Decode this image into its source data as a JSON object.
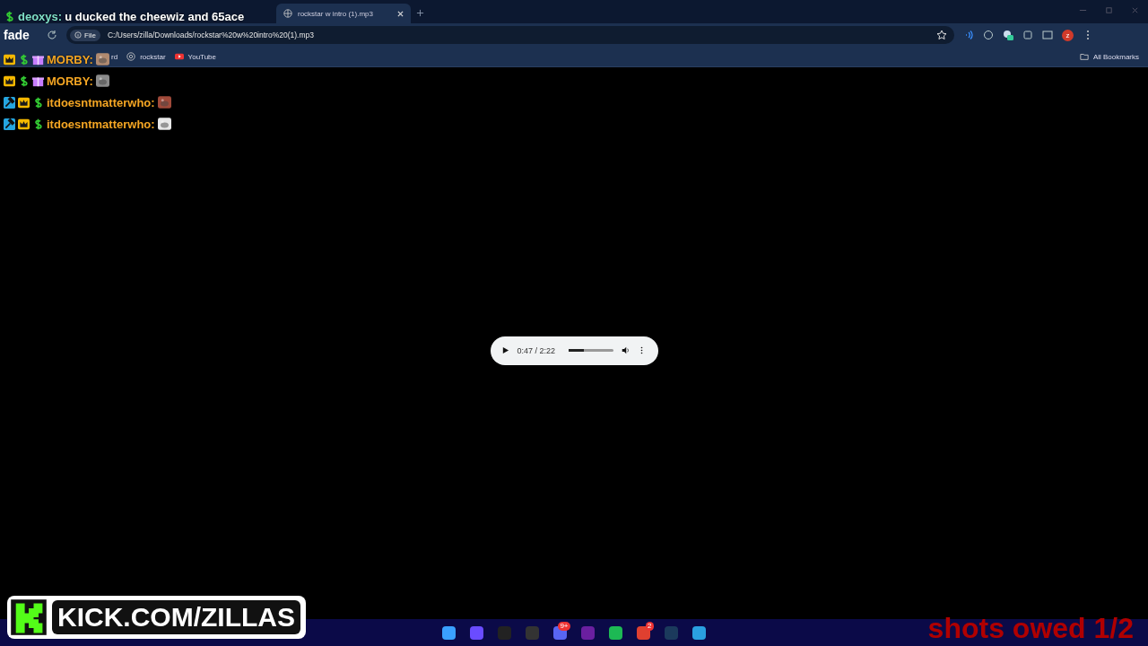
{
  "browser": {
    "tabs": [
      {
        "kind": "file",
        "title": "rockstar w intro (1).mp3",
        "selected": true
      }
    ],
    "address": {
      "chip": "File",
      "url": "C:/Users/zilla/Downloads/rockstar%20w%20intro%20(1).mp3"
    },
    "profile": "z",
    "bookmarks": [
      {
        "kind": "page",
        "label": "rd"
      },
      {
        "kind": "globe",
        "label": "rockstar"
      },
      {
        "kind": "youtube",
        "label": "YouTube"
      }
    ],
    "all_bookmarks": "All Bookmarks"
  },
  "player": {
    "time": "0:47 / 2:22",
    "level": 0.33
  },
  "chat": [
    {
      "kind": "message",
      "badges": [
        {
          "kind": "dollar"
        }
      ],
      "user": "deoxys:",
      "color": "#7fe0c8",
      "text": "u ducked the cheewiz and 65ace"
    },
    {
      "kind": "fragment",
      "text": "fade"
    },
    {
      "kind": "message",
      "badges": [
        {
          "kind": "crown"
        },
        {
          "kind": "dollar"
        },
        {
          "kind": "gift"
        }
      ],
      "user": "MORBY:",
      "color": "#f5a623"
    },
    {
      "kind": "message",
      "badges": [
        {
          "kind": "crown"
        },
        {
          "kind": "dollar"
        },
        {
          "kind": "gift"
        }
      ],
      "user": "MORBY:",
      "color": "#f5a623"
    },
    {
      "kind": "message",
      "badges": [
        {
          "kind": "mod"
        },
        {
          "kind": "crown"
        },
        {
          "kind": "dollar"
        }
      ],
      "user": "itdoesntmatterwho:",
      "color": "#f5a623"
    },
    {
      "kind": "message",
      "badges": [
        {
          "kind": "mod"
        },
        {
          "kind": "crown"
        },
        {
          "kind": "dollar"
        }
      ],
      "user": "itdoesntmatterwho:",
      "color": "#f5a623"
    }
  ],
  "stream": {
    "link": "KICK.COM/ZILLAS",
    "shots": "shots owed 1/2"
  },
  "taskbar": [
    {
      "kind": "windows"
    },
    {
      "kind": "grid"
    },
    {
      "kind": "g"
    },
    {
      "kind": "obs"
    },
    {
      "kind": "discord",
      "badge": "9+"
    },
    {
      "kind": "next"
    },
    {
      "kind": "spotify"
    },
    {
      "kind": "chrome",
      "badge": "2"
    },
    {
      "kind": "steam"
    },
    {
      "kind": "telegram"
    }
  ]
}
